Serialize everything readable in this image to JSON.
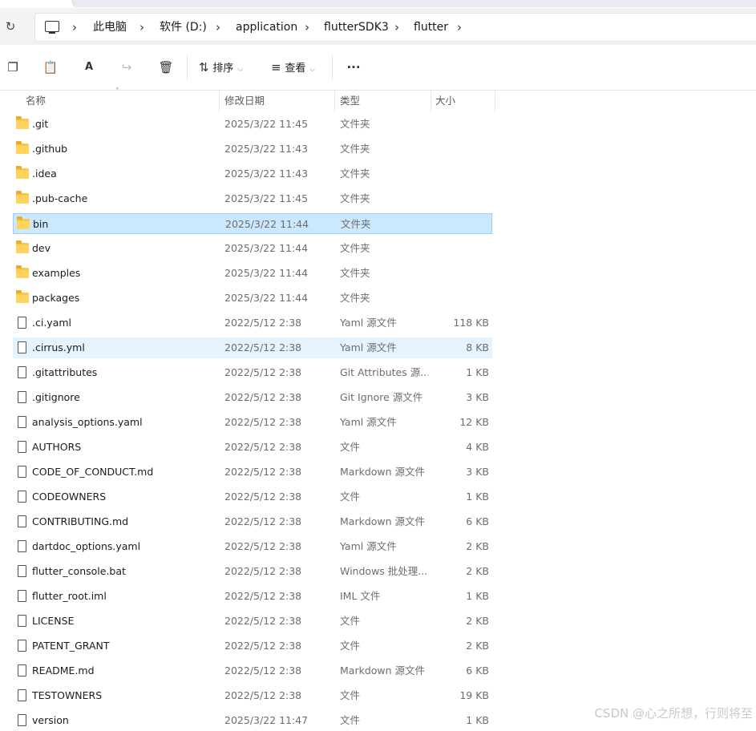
{
  "breadcrumb": [
    "此电脑",
    "软件 (D:)",
    "application",
    "flutterSDK3",
    "flutter"
  ],
  "toolbar": {
    "sort_label": "排序",
    "view_label": "查看",
    "more_label": "···"
  },
  "columns": {
    "name": "名称",
    "date": "修改日期",
    "type": "类型",
    "size": "大小"
  },
  "files": [
    {
      "name": ".git",
      "date": "2025/3/22 11:45",
      "type": "文件夹",
      "size": "",
      "kind": "folder"
    },
    {
      "name": ".github",
      "date": "2025/3/22 11:43",
      "type": "文件夹",
      "size": "",
      "kind": "folder"
    },
    {
      "name": ".idea",
      "date": "2025/3/22 11:43",
      "type": "文件夹",
      "size": "",
      "kind": "folder"
    },
    {
      "name": ".pub-cache",
      "date": "2025/3/22 11:45",
      "type": "文件夹",
      "size": "",
      "kind": "folder"
    },
    {
      "name": "bin",
      "date": "2025/3/22 11:44",
      "type": "文件夹",
      "size": "",
      "kind": "folder",
      "state": "selected"
    },
    {
      "name": "dev",
      "date": "2025/3/22 11:44",
      "type": "文件夹",
      "size": "",
      "kind": "folder"
    },
    {
      "name": "examples",
      "date": "2025/3/22 11:44",
      "type": "文件夹",
      "size": "",
      "kind": "folder"
    },
    {
      "name": "packages",
      "date": "2025/3/22 11:44",
      "type": "文件夹",
      "size": "",
      "kind": "folder"
    },
    {
      "name": ".ci.yaml",
      "date": "2022/5/12 2:38",
      "type": "Yaml 源文件",
      "size": "118 KB",
      "kind": "file"
    },
    {
      "name": ".cirrus.yml",
      "date": "2022/5/12 2:38",
      "type": "Yaml 源文件",
      "size": "8 KB",
      "kind": "file",
      "state": "hover"
    },
    {
      "name": ".gitattributes",
      "date": "2022/5/12 2:38",
      "type": "Git Attributes 源...",
      "size": "1 KB",
      "kind": "file"
    },
    {
      "name": ".gitignore",
      "date": "2022/5/12 2:38",
      "type": "Git Ignore 源文件",
      "size": "3 KB",
      "kind": "file"
    },
    {
      "name": "analysis_options.yaml",
      "date": "2022/5/12 2:38",
      "type": "Yaml 源文件",
      "size": "12 KB",
      "kind": "file"
    },
    {
      "name": "AUTHORS",
      "date": "2022/5/12 2:38",
      "type": "文件",
      "size": "4 KB",
      "kind": "file"
    },
    {
      "name": "CODE_OF_CONDUCT.md",
      "date": "2022/5/12 2:38",
      "type": "Markdown 源文件",
      "size": "3 KB",
      "kind": "file"
    },
    {
      "name": "CODEOWNERS",
      "date": "2022/5/12 2:38",
      "type": "文件",
      "size": "1 KB",
      "kind": "file"
    },
    {
      "name": "CONTRIBUTING.md",
      "date": "2022/5/12 2:38",
      "type": "Markdown 源文件",
      "size": "6 KB",
      "kind": "file"
    },
    {
      "name": "dartdoc_options.yaml",
      "date": "2022/5/12 2:38",
      "type": "Yaml 源文件",
      "size": "2 KB",
      "kind": "file"
    },
    {
      "name": "flutter_console.bat",
      "date": "2022/5/12 2:38",
      "type": "Windows 批处理...",
      "size": "2 KB",
      "kind": "file"
    },
    {
      "name": "flutter_root.iml",
      "date": "2022/5/12 2:38",
      "type": "IML 文件",
      "size": "1 KB",
      "kind": "file"
    },
    {
      "name": "LICENSE",
      "date": "2022/5/12 2:38",
      "type": "文件",
      "size": "2 KB",
      "kind": "file"
    },
    {
      "name": "PATENT_GRANT",
      "date": "2022/5/12 2:38",
      "type": "文件",
      "size": "2 KB",
      "kind": "file"
    },
    {
      "name": "README.md",
      "date": "2022/5/12 2:38",
      "type": "Markdown 源文件",
      "size": "6 KB",
      "kind": "file"
    },
    {
      "name": "TESTOWNERS",
      "date": "2022/5/12 2:38",
      "type": "文件",
      "size": "19 KB",
      "kind": "file"
    },
    {
      "name": "version",
      "date": "2025/3/22 11:47",
      "type": "文件",
      "size": "1 KB",
      "kind": "file"
    }
  ],
  "watermark": "CSDN @心之所想，行则将至"
}
